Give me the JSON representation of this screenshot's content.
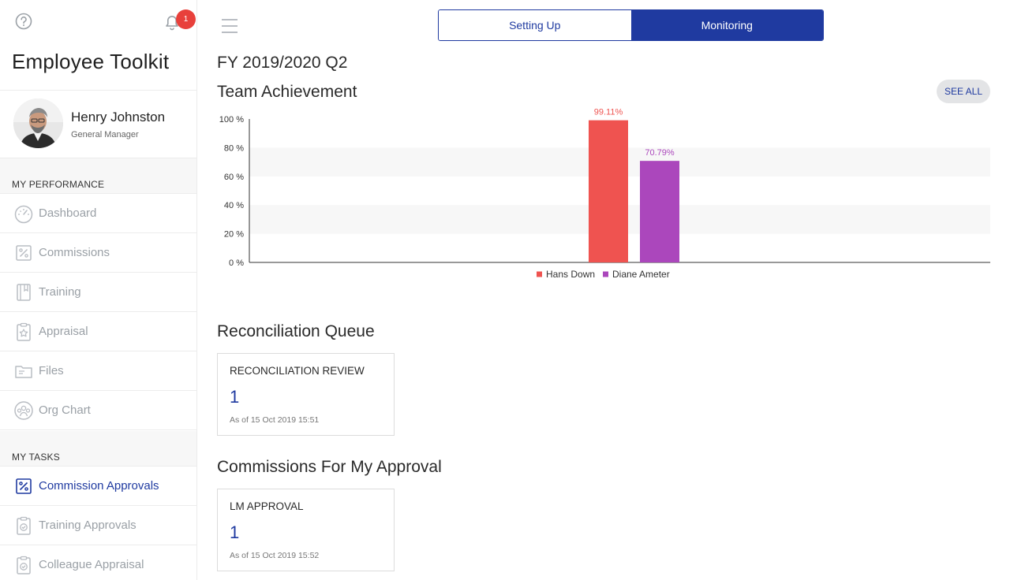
{
  "sidebar": {
    "notification_count": "1",
    "app_title": "Employee Toolkit",
    "profile": {
      "name": "Henry Johnston",
      "role": "General Manager"
    },
    "sections": [
      {
        "heading": "MY PERFORMANCE",
        "items": [
          {
            "label": "Dashboard",
            "icon": "gauge-icon"
          },
          {
            "label": "Commissions",
            "icon": "percent-icon"
          },
          {
            "label": "Training",
            "icon": "book-icon"
          },
          {
            "label": "Appraisal",
            "icon": "clipboard-star-icon"
          },
          {
            "label": "Files",
            "icon": "folder-icon"
          },
          {
            "label": "Org Chart",
            "icon": "people-circle-icon"
          }
        ]
      },
      {
        "heading": "MY TASKS",
        "items": [
          {
            "label": "Commission Approvals",
            "icon": "percent-icon",
            "active": true
          },
          {
            "label": "Training Approvals",
            "icon": "clipboard-check-icon"
          },
          {
            "label": "Colleague Appraisal",
            "icon": "clipboard-check-icon"
          }
        ]
      }
    ]
  },
  "header": {
    "toggle": {
      "setup_label": "Setting Up",
      "monitor_label": "Monitoring",
      "selected": "Monitoring"
    }
  },
  "main": {
    "period": "FY 2019/2020 Q2",
    "team": {
      "title": "Team Achievement",
      "see_all_label": "SEE ALL"
    },
    "recon": {
      "title": "Reconciliation Queue",
      "card": {
        "title": "RECONCILIATION REVIEW",
        "value": "1",
        "date": "As of 15 Oct 2019 15:51"
      }
    },
    "approval": {
      "title": "Commissions For My Approval",
      "card": {
        "title": "LM APPROVAL",
        "value": "1",
        "date": "As of 15 Oct 2019 15:52"
      }
    }
  },
  "colors": {
    "accent": "#1f3aa0",
    "badge": "#e8403b",
    "series_1": "#ef5350",
    "series_2": "#ab47bc"
  },
  "chart_data": {
    "type": "bar",
    "title": "",
    "xlabel": "",
    "ylabel": "",
    "ylim": [
      0,
      100
    ],
    "yticks": [
      "0 %",
      "20 %",
      "40 %",
      "60 %",
      "80 %",
      "100 %"
    ],
    "grid": "alternating horizontal bands",
    "legend": "bottom-center",
    "series": [
      {
        "name": "Hans Down",
        "values": [
          99.11
        ],
        "label": "99.11%",
        "color": "#ef5350"
      },
      {
        "name": "Diane Ameter",
        "values": [
          70.79
        ],
        "label": "70.79%",
        "color": "#ab47bc"
      }
    ]
  }
}
